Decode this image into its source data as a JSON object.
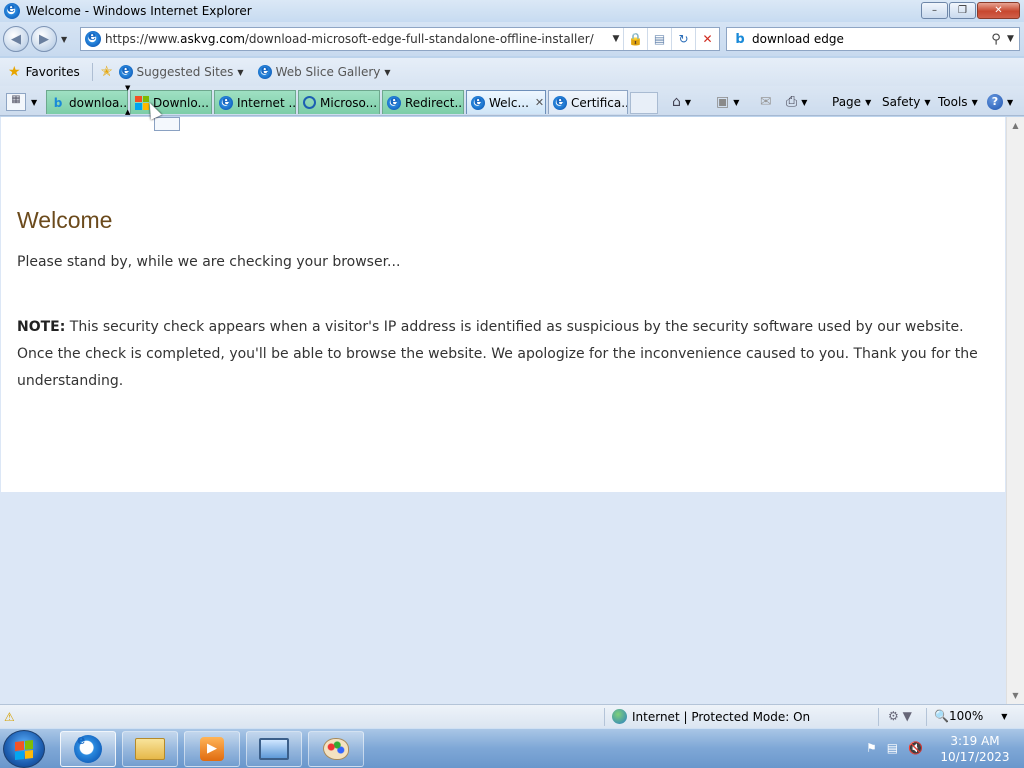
{
  "window": {
    "title": "Welcome - Windows Internet Explorer"
  },
  "address_bar": {
    "url_prefix": "https://www.",
    "url_host": "askvg.com",
    "url_path": "/download-microsoft-edge-full-standalone-offline-installer/"
  },
  "search": {
    "value": "download edge"
  },
  "favorites_bar": {
    "favorites_label": "Favorites",
    "links": [
      {
        "label": "Suggested Sites"
      },
      {
        "label": "Web Slice Gallery"
      }
    ]
  },
  "tabs": [
    {
      "label": "downloa...",
      "icon": "bing-icon"
    },
    {
      "label": "Downlo...",
      "icon": "microsoft-logo-icon"
    },
    {
      "label": "Internet ...",
      "icon": "ie-icon"
    },
    {
      "label": "Microso...",
      "icon": "app-icon"
    },
    {
      "label": "Redirect...",
      "icon": "ie-icon"
    },
    {
      "label": "Welc...",
      "icon": "ie-icon",
      "active": true
    },
    {
      "label": "Certifica...",
      "icon": "ie-icon"
    }
  ],
  "command_bar": {
    "page_label": "Page",
    "safety_label": "Safety",
    "tools_label": "Tools"
  },
  "page": {
    "heading": "Welcome",
    "standby": "Please stand by, while we are checking your browser...",
    "note_label": "NOTE:",
    "note_text": "This security check appears when a visitor's IP address is identified as suspicious by the security software used by our website. Once the check is completed, you'll be able to browse the website. We apologize for the inconvenience caused to you. Thank you for the understanding."
  },
  "status_bar": {
    "zone": "Internet | Protected Mode: On",
    "zoom": "100%"
  },
  "taskbar": {
    "time": "3:19 AM",
    "date": "10/17/2023"
  },
  "colors": {
    "tab_green": "#8fd8b6",
    "heading_brown": "#6b4a1c",
    "viewport_blue": "#dce7f6"
  }
}
